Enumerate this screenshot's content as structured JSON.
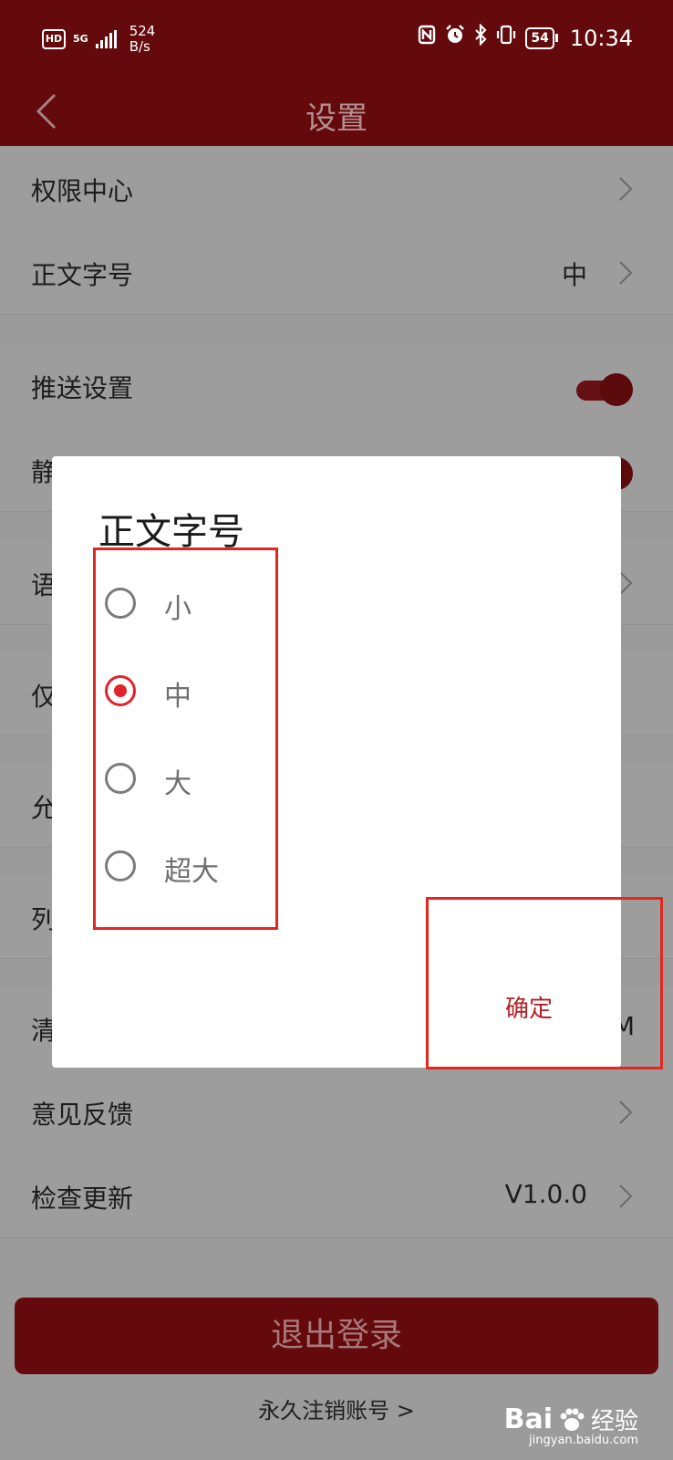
{
  "status_bar": {
    "hd": "HD",
    "network": "5G",
    "speed_value": "524",
    "speed_unit": "B/s",
    "battery": "54",
    "time": "10:34",
    "icons": [
      "nfc-icon",
      "alarm-icon",
      "bluetooth-icon",
      "vibrate-icon"
    ]
  },
  "header": {
    "title": "设置"
  },
  "settings": {
    "items": [
      {
        "label": "权限中心"
      },
      {
        "label": "正文字号",
        "value": "中"
      },
      {
        "label": "推送设置",
        "toggle": true
      },
      {
        "label": "静"
      },
      {
        "label": "语"
      },
      {
        "label": "仅"
      },
      {
        "label": "允"
      },
      {
        "label": "列"
      },
      {
        "label": "清",
        "value": "M"
      },
      {
        "label": "意见反馈"
      },
      {
        "label": "检查更新",
        "value": "V1.0.0"
      }
    ]
  },
  "logout": {
    "label": "退出登录"
  },
  "deactivate": {
    "label": "永久注销账号 >"
  },
  "dialog": {
    "title": "正文字号",
    "options": [
      {
        "label": "小",
        "selected": false
      },
      {
        "label": "中",
        "selected": true
      },
      {
        "label": "大",
        "selected": false
      },
      {
        "label": "超大",
        "selected": false
      }
    ],
    "confirm": "确定"
  },
  "watermark": {
    "logo": "Bai",
    "cn": "经验",
    "url": "jingyan.baidu.com"
  },
  "colors": {
    "accent": "#e2242a",
    "header_dimmed": "#640a0c",
    "overlay_bg": "#9b9b9b",
    "annotation": "#e0281f"
  }
}
